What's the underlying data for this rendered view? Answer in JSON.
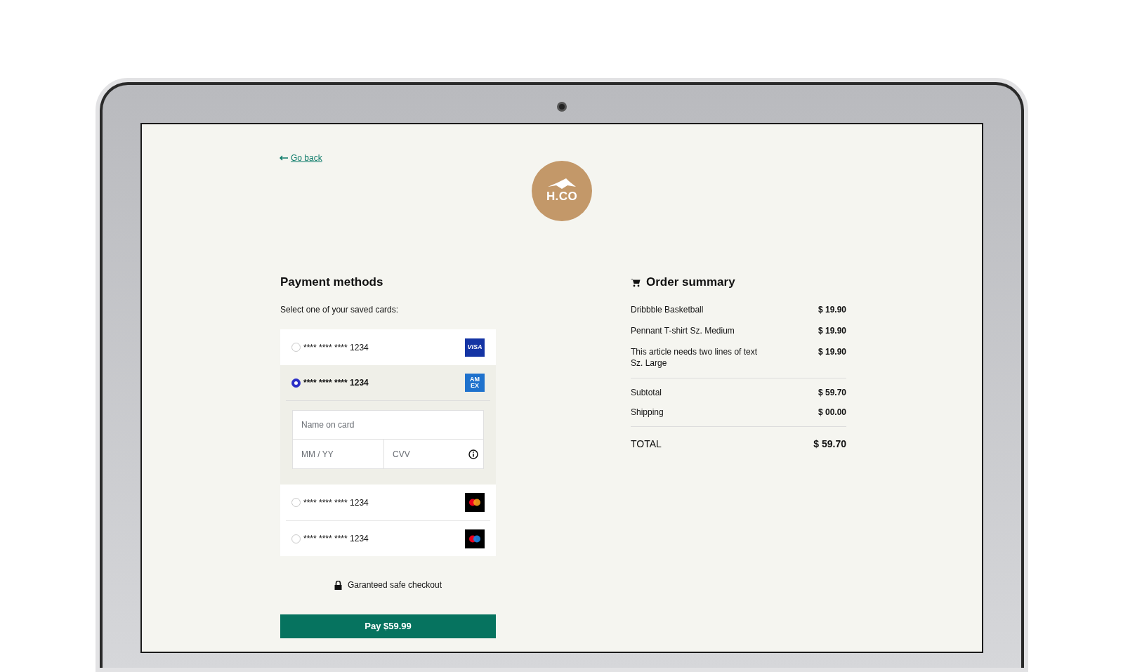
{
  "back_link": "Go back",
  "logo": {
    "text": "H.CO"
  },
  "payment": {
    "title": "Payment methods",
    "subtitle": "Select one of your saved cards:",
    "cards": [
      {
        "number": "**** **** **** 1234",
        "kind": "visa",
        "brand_text": "VISA",
        "selected": false
      },
      {
        "number": "**** **** **** 1234",
        "kind": "amex",
        "brand_text": "AM EX",
        "selected": true
      },
      {
        "number": "**** **** **** 1234",
        "kind": "mastercard",
        "selected": false
      },
      {
        "number": "**** **** **** 1234",
        "kind": "maestro",
        "selected": false
      }
    ],
    "form": {
      "name_placeholder": "Name on card",
      "expiry_placeholder": "MM / YY",
      "cvv_placeholder": "CVV"
    },
    "safe_note": "Garanteed safe checkout",
    "pay_button": "Pay $59.99"
  },
  "summary": {
    "title": "Order summary",
    "items": [
      {
        "name": "Dribbble Basketball",
        "price": "$ 19.90"
      },
      {
        "name": "Pennant T-shirt Sz. Medium",
        "price": "$ 19.90"
      },
      {
        "name": "This article needs two lines of text",
        "detail": "Sz. Large",
        "price": "$ 19.90"
      }
    ],
    "subtotal": {
      "label": "Subtotal",
      "value": "$ 59.70"
    },
    "shipping": {
      "label": "Shipping",
      "value": "$ 00.00"
    },
    "total": {
      "label": "TOTAL",
      "value": "$ 59.70"
    }
  }
}
